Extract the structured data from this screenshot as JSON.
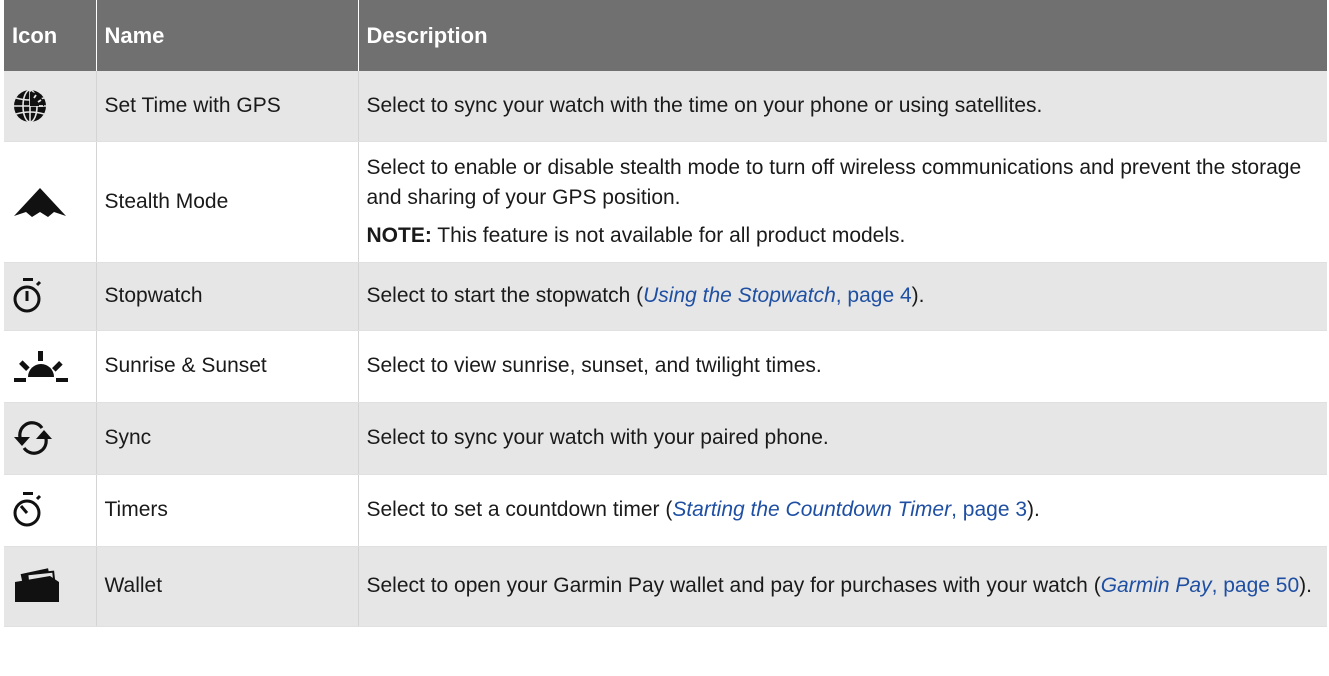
{
  "table": {
    "headers": {
      "icon": "Icon",
      "name": "Name",
      "description": "Description"
    },
    "rows": [
      {
        "icon": "globe-clock-icon",
        "name": "Set Time with GPS",
        "description": "Select to sync your watch with the time on your phone or using satellites."
      },
      {
        "icon": "stealth-aircraft-icon",
        "name": "Stealth Mode",
        "description": "Select to enable or disable stealth mode to turn off wireless communications and prevent the storage and sharing of your GPS position.",
        "note_label": "NOTE:",
        "note_text": " This feature is not available for all product models."
      },
      {
        "icon": "stopwatch-icon",
        "name": "Stopwatch",
        "description_pre": "Select to start the stopwatch (",
        "link_title": "Using the Stopwatch",
        "link_page": ", page 4",
        "description_post": ")."
      },
      {
        "icon": "sunrise-icon",
        "name": "Sunrise & Sunset",
        "description": "Select to view sunrise, sunset, and twilight times."
      },
      {
        "icon": "sync-arrows-icon",
        "name": "Sync",
        "description": "Select to sync your watch with your paired phone."
      },
      {
        "icon": "timer-icon",
        "name": "Timers",
        "description_pre": "Select to set a countdown timer (",
        "link_title": "Starting the Countdown Timer",
        "link_page": ", page 3",
        "description_post": ")."
      },
      {
        "icon": "wallet-icon",
        "name": "Wallet",
        "description_pre": "Select to open your Garmin Pay wallet and pay for purchases with your watch (",
        "link_title": "Garmin Pay",
        "link_page": ", page 50",
        "description_post": ")."
      }
    ]
  },
  "colors": {
    "header_bg": "#707070",
    "row_shade": "#e6e6e6",
    "link": "#1f4fa3"
  }
}
